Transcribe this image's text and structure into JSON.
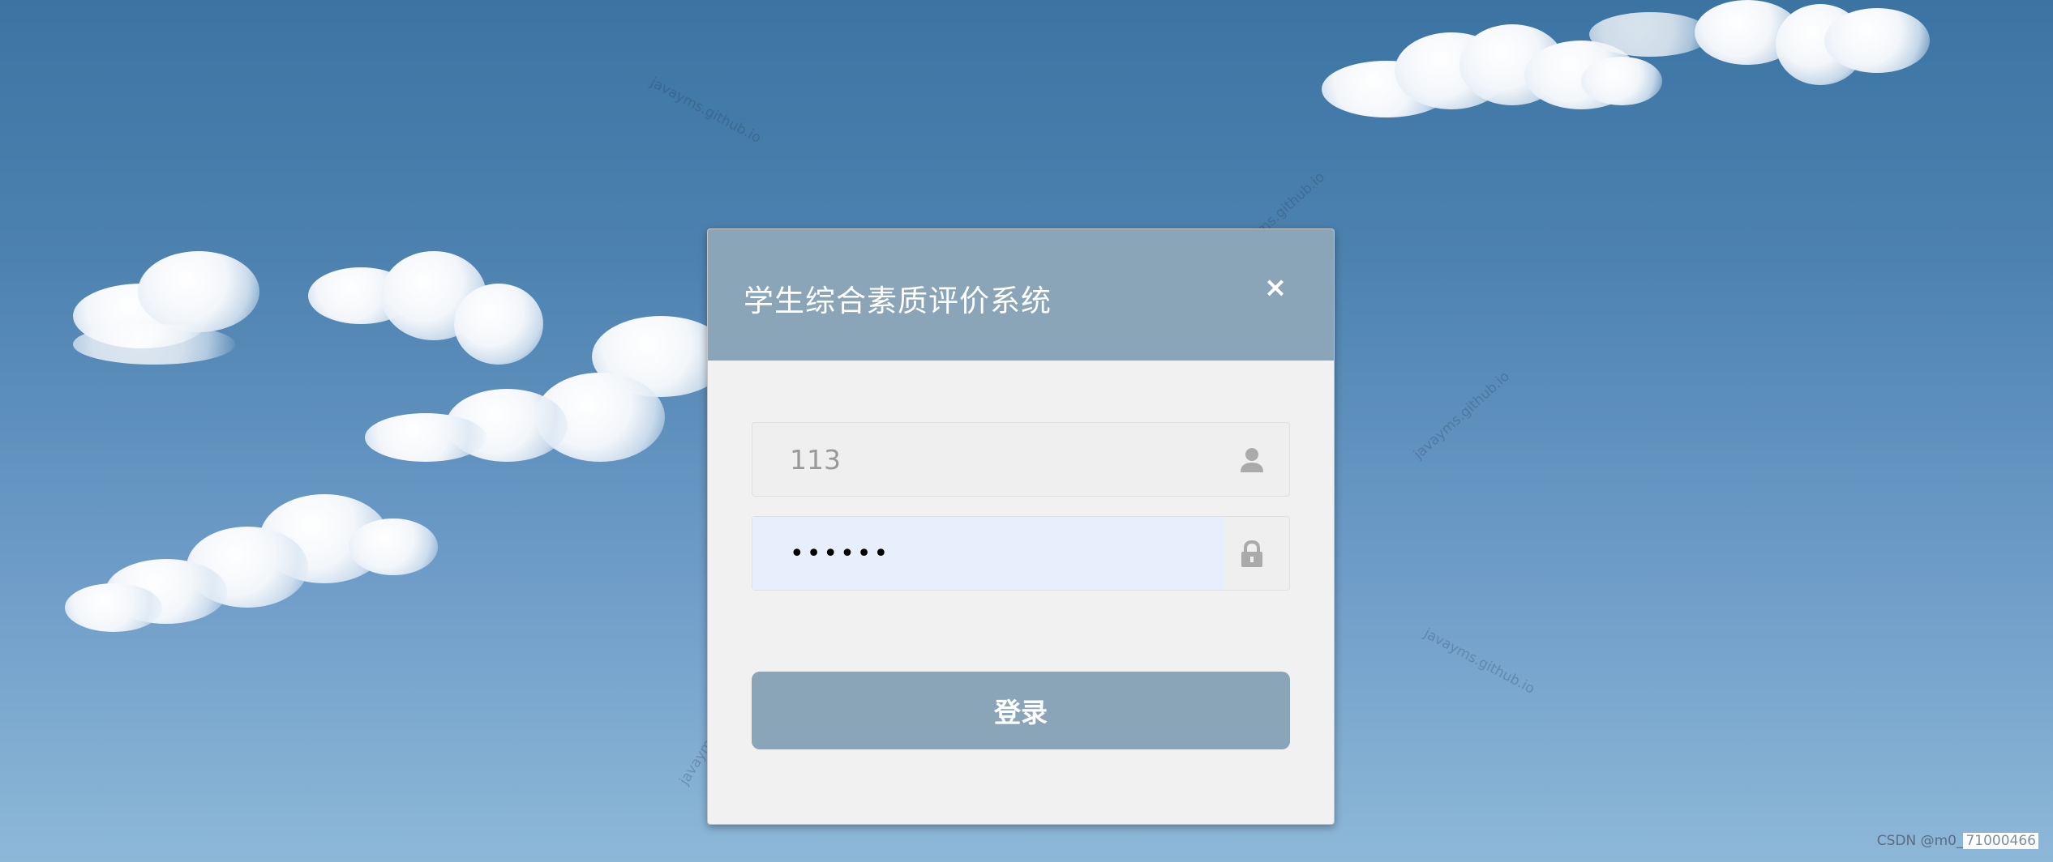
{
  "dialog": {
    "title": "学生综合素质评价系统",
    "close_label": "×"
  },
  "form": {
    "username_value": "113",
    "password_value": "••••••",
    "login_label": "登录"
  },
  "watermark_text": "javayms.github.io",
  "credit": {
    "prefix": "CSDN @m0_",
    "highlight": "71000466"
  },
  "colors": {
    "header": "#8aa4b8",
    "button": "#8aa4b8",
    "body": "#f1f1f1",
    "password_autofill": "#e8effc"
  },
  "icons": {
    "username": "user-icon",
    "password": "lock-icon",
    "close": "close-icon"
  }
}
